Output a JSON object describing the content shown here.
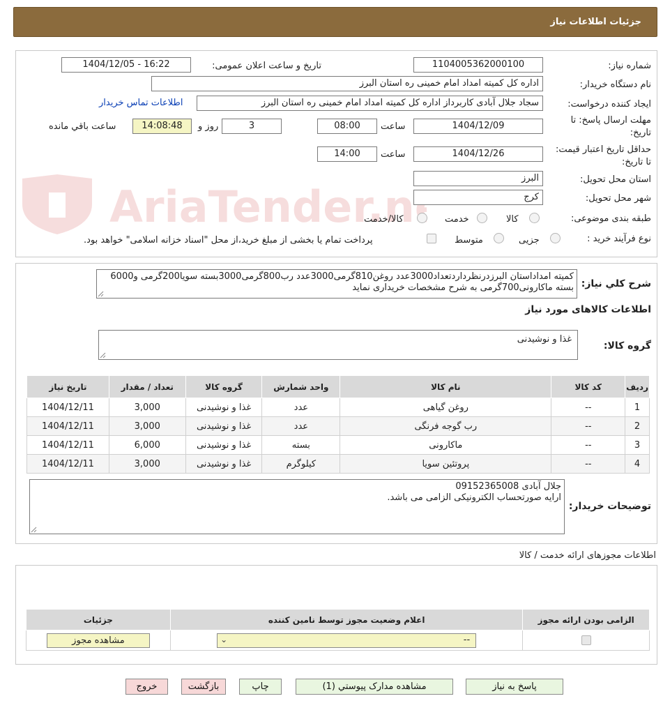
{
  "header": {
    "title": "جزئیات اطلاعات نیاز"
  },
  "watermark": {
    "text": "AriaTender.neT"
  },
  "info": {
    "need_number_label": "شماره نیاز:",
    "need_number": "1104005362000100",
    "announce_label": "تاریخ و ساعت اعلان عمومی:",
    "announce_value": "1404/12/05 - 16:22",
    "buyer_label": "نام دستگاه خریدار:",
    "buyer_value": "اداره کل کمیته امداد امام خمینی  ره  استان البرز",
    "creator_label": "ایجاد کننده درخواست:",
    "creator_value": "سجاد جلال آبادی کاربرداز اداره کل کمیته امداد امام خمینی  ره  استان البرز",
    "contact_link": "اطلاعات تماس خریدار",
    "deadline_label": "مهلت ارسال پاسخ: تا تاریخ:",
    "deadline_date": "1404/12/09",
    "time_label": "ساعت",
    "deadline_time": "08:00",
    "days_value": "3",
    "days_label": "روز و",
    "remaining_time": "14:08:48",
    "remaining_label": "ساعت باقي مانده",
    "validity_label": "حداقل تاریخ اعتبار قیمت: تا تاریخ:",
    "validity_date": "1404/12/26",
    "validity_time": "14:00",
    "province_label": "استان محل تحویل:",
    "province_value": "البرز",
    "city_label": "شهر محل تحویل:",
    "city_value": "کرج",
    "category_label": "طبقه بندی موضوعی:",
    "category_options": [
      "کالا",
      "خدمت",
      "کالا/خدمت"
    ],
    "process_label": "نوع فرآیند خرید :",
    "process_options": [
      "جزیی",
      "متوسط"
    ],
    "payment_note": "پرداخت تمام یا بخشی از مبلغ خرید،از محل \"اسناد خزانه اسلامی\" خواهد بود."
  },
  "description": {
    "label": "شرح کلي نياز:",
    "text": "کمیته امداداستان البرزدرنظرداردتعداد3000عدد روغن810گرمی3000عدد رب800گرمی3000بسته سویا200گرمی و6000 بسته ماکارونی700گرمی به شرح مشخصات خریداری نماید"
  },
  "goods": {
    "section_title": "اطلاعات کالاهای مورد نیاز",
    "group_label": "گروه کالا:",
    "group_value": "غذا و نوشیدنی",
    "columns": [
      "ردیف",
      "کد کالا",
      "نام کالا",
      "واحد شمارش",
      "گروه کالا",
      "تعداد / مقدار",
      "تاریخ نیاز"
    ],
    "rows": [
      [
        "1",
        "--",
        "روغن گیاهی",
        "عدد",
        "غذا و نوشیدنی",
        "3,000",
        "1404/12/11"
      ],
      [
        "2",
        "--",
        "رب گوجه فرنگی",
        "عدد",
        "غذا و نوشیدنی",
        "3,000",
        "1404/12/11"
      ],
      [
        "3",
        "--",
        "ماکارونی",
        "بسته",
        "غذا و نوشیدنی",
        "6,000",
        "1404/12/11"
      ],
      [
        "4",
        "--",
        "پروتئین سویا",
        "کیلوگرم",
        "غذا و نوشیدنی",
        "3,000",
        "1404/12/11"
      ]
    ]
  },
  "buyer_notes": {
    "label": "توضیحات خریدار:",
    "line1": "جلال آبادی 09152365008",
    "line2": "ارایه صورتحساب الکترونیکی الزامی می باشد."
  },
  "permits": {
    "section_title": "اطلاعات مجوزهای ارائه خدمت / کالا",
    "columns": [
      "الزامی بودن ارائه مجوز",
      "اعلام وضعیت مجوز توسط نامین کننده",
      "جزئیات"
    ],
    "select_value": "--",
    "view_button": "مشاهده مجوز"
  },
  "actions": {
    "reply": "پاسخ به نیاز",
    "attachments": "مشاهده مدارک پیوستي (1)",
    "print": "چاپ",
    "back": "بازگشت",
    "exit": "خروج"
  }
}
